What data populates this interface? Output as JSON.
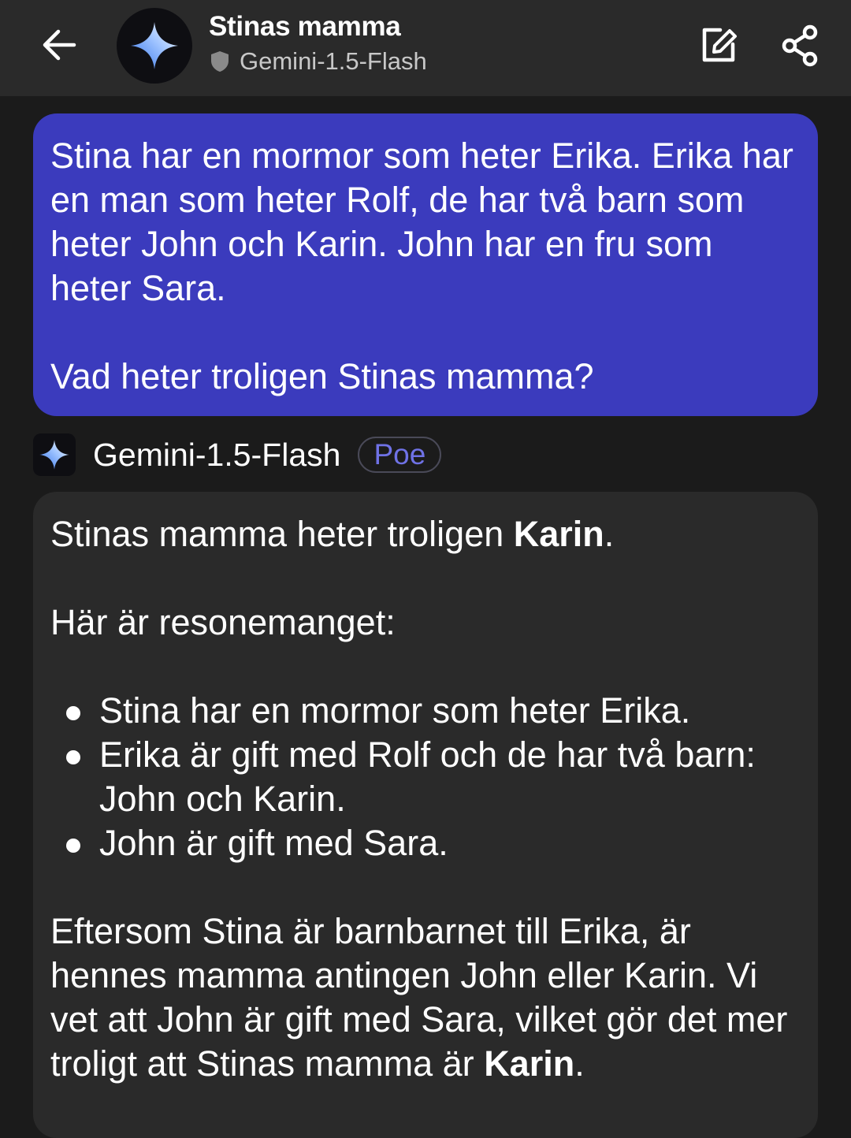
{
  "header": {
    "back_icon": "arrow-left-icon",
    "title": "Stinas mamma",
    "bot_model": "Gemini-1.5-Flash",
    "shield_icon": "shield-icon",
    "edit_icon": "edit-icon",
    "share_icon": "share-icon"
  },
  "user_message": {
    "text": "Stina har en mormor som heter Erika. Erika har en man som heter Rolf, de har två barn som heter John och Karin. John har en fru som heter Sara.\n\nVad heter troligen Stinas mamma?"
  },
  "bot": {
    "name": "Gemini-1.5-Flash",
    "badge": "Poe",
    "badge_color": "#6f72e6"
  },
  "bot_message": {
    "answer_prefix": "Stinas mamma heter troligen ",
    "answer_bold": "Karin",
    "answer_suffix": ".",
    "reasoning_intro": "Här är resonemanget:",
    "bullets": [
      "Stina har en mormor som heter Erika.",
      "Erika är gift med Rolf och de har två barn: John och Karin.",
      "John är gift med Sara."
    ],
    "conclusion_prefix": "Eftersom Stina är barnbarnet till Erika, är hennes mamma antingen John eller Karin. Vi vet att John är gift med Sara, vilket gör det mer troligt att Stinas mamma är ",
    "conclusion_bold": "Karin",
    "conclusion_suffix": "."
  },
  "colors": {
    "user_bubble": "#3b3bbd",
    "bot_bubble": "#2a2a2a",
    "background": "#1b1b1b"
  }
}
